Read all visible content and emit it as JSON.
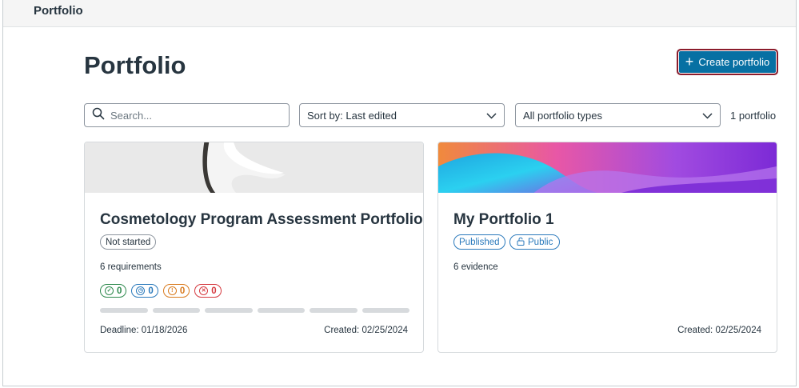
{
  "topbar": {
    "title": "Portfolio"
  },
  "page": {
    "title": "Portfolio"
  },
  "toolbar": {
    "create_label": "Create portfolio",
    "search_placeholder": "Search...",
    "sort_value": "Sort by: Last edited",
    "type_value": "All portfolio types",
    "count_text": "1 portfolio"
  },
  "cards": [
    {
      "title": "Cosmetology Program Assessment Portfolio",
      "status": "Not started",
      "requirements": "6 requirements",
      "counts": {
        "complete": "0",
        "pending": "0",
        "attention": "0",
        "rejected": "0"
      },
      "progress_segments": 6,
      "deadline": "Deadline: 01/18/2026",
      "created": "Created: 02/25/2024"
    },
    {
      "title": "My Portfolio 1",
      "status": "Published",
      "visibility": "Public",
      "evidence": "6 evidence",
      "created": "Created: 02/25/2024"
    }
  ],
  "colors": {
    "primary": "#0770a3",
    "focus_ring": "#8b1c2c",
    "text": "#273540",
    "green": "#2f8a4e",
    "blue": "#2b7abc",
    "orange": "#d97b1f",
    "red": "#d5383e"
  }
}
